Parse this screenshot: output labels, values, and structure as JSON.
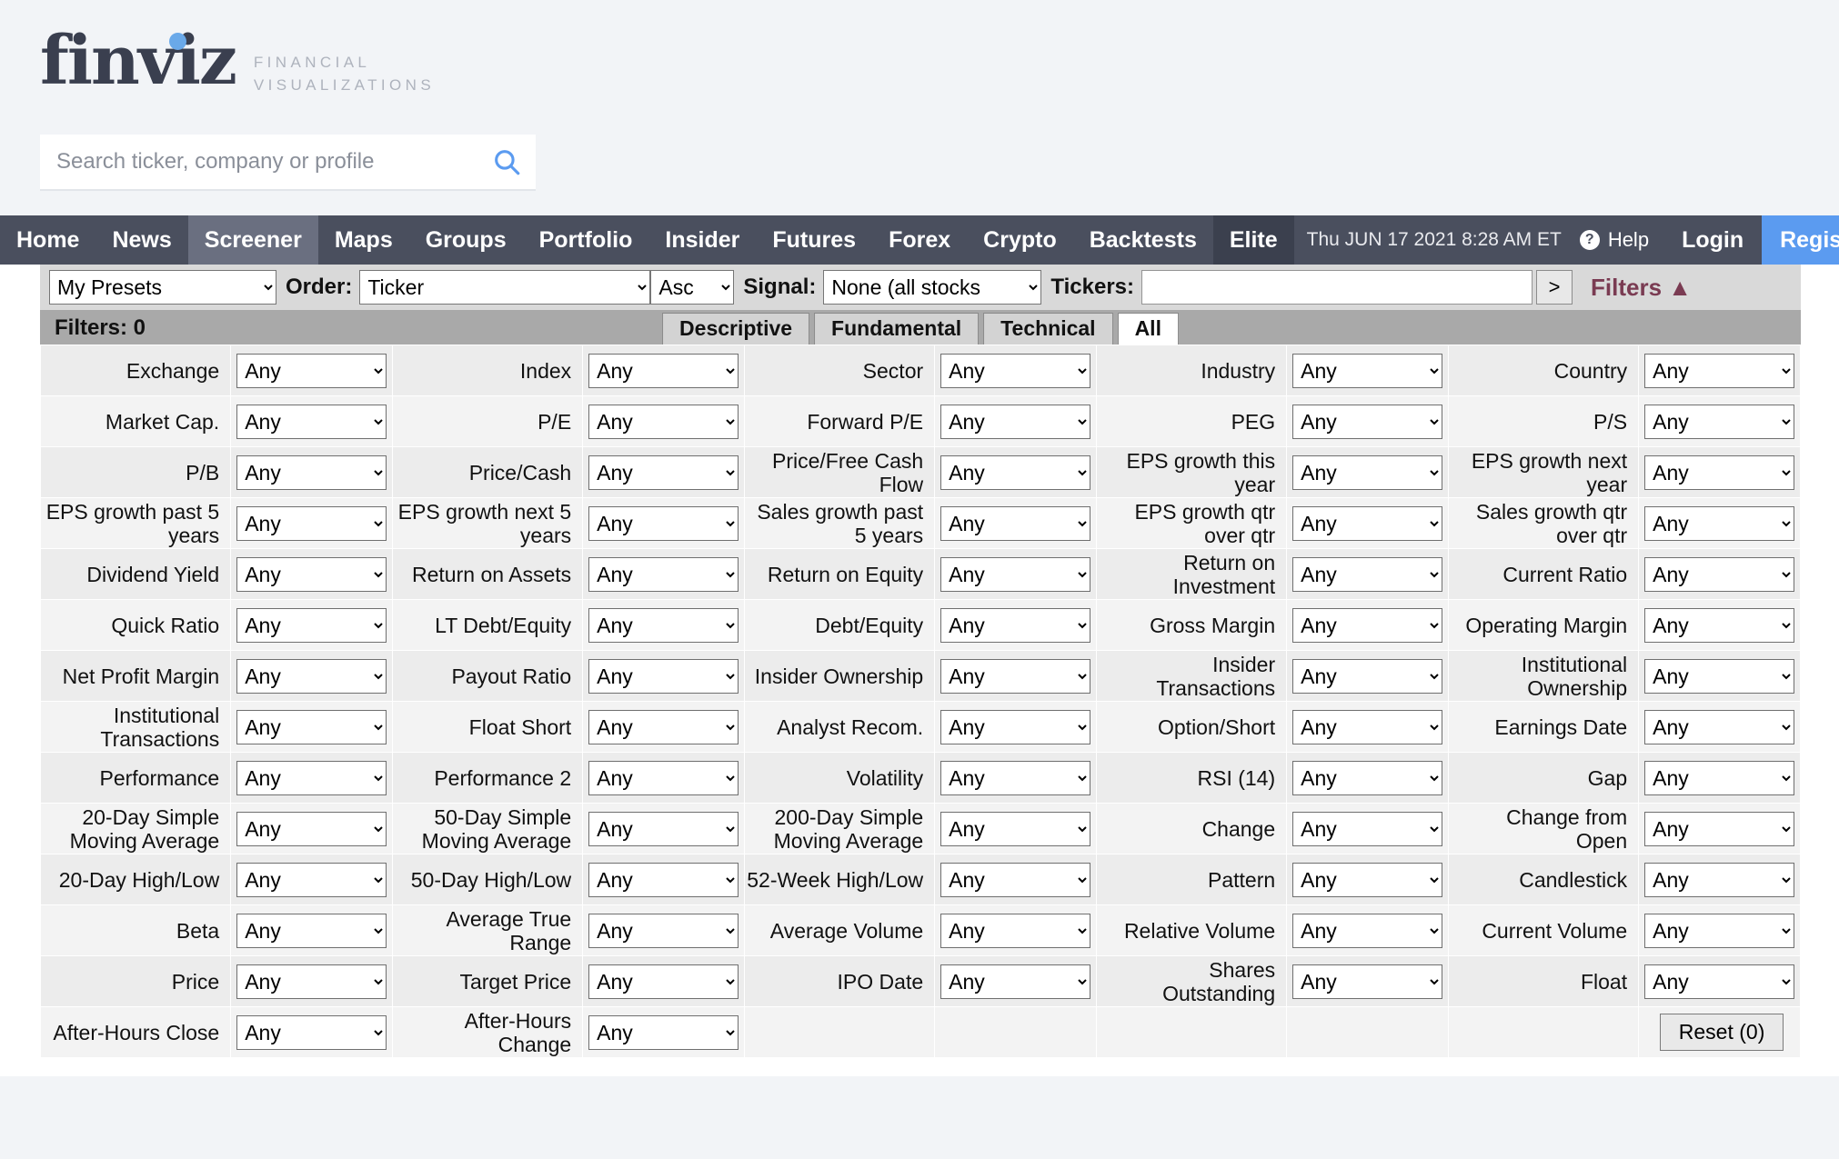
{
  "brand": {
    "name": "finviz",
    "tagline_line1": "FINANCIAL",
    "tagline_line2": "VISUALIZATIONS"
  },
  "search": {
    "placeholder": "Search ticker, company or profile",
    "value": "",
    "icon": "search-icon"
  },
  "nav": {
    "items": [
      {
        "label": "Home",
        "state": "normal"
      },
      {
        "label": "News",
        "state": "normal"
      },
      {
        "label": "Screener",
        "state": "active"
      },
      {
        "label": "Maps",
        "state": "normal"
      },
      {
        "label": "Groups",
        "state": "normal"
      },
      {
        "label": "Portfolio",
        "state": "normal"
      },
      {
        "label": "Insider",
        "state": "normal"
      },
      {
        "label": "Futures",
        "state": "normal"
      },
      {
        "label": "Forex",
        "state": "normal"
      },
      {
        "label": "Crypto",
        "state": "normal"
      },
      {
        "label": "Backtests",
        "state": "normal"
      },
      {
        "label": "Elite",
        "state": "elite"
      }
    ],
    "timestamp": "Thu JUN 17 2021 8:28 AM ET",
    "help_label": "Help",
    "help_icon": "question-mark-icon",
    "login_label": "Login",
    "register_label": "Register",
    "colors": {
      "bar": "#4a4f5e",
      "active": "#6a6f80",
      "elite": "#3b404e",
      "register": "#5b9bf0"
    }
  },
  "toolbar": {
    "presets_value": "My Presets",
    "order_label": "Order:",
    "order_value": "Ticker",
    "direction_value": "Asc",
    "signal_label": "Signal:",
    "signal_value": "None (all stocks",
    "tickers_label": "Tickers:",
    "tickers_value": "",
    "go_label": ">",
    "filters_toggle": "Filters ▲",
    "filters_toggle_color": "#7a3b52"
  },
  "tabstrip": {
    "filters_count": "Filters: 0",
    "tabs": [
      {
        "label": "Descriptive",
        "active": false
      },
      {
        "label": "Fundamental",
        "active": false
      },
      {
        "label": "Technical",
        "active": false
      },
      {
        "label": "All",
        "active": true
      }
    ]
  },
  "filters": {
    "default_value": "Any",
    "reset_label": "Reset (0)",
    "rows": [
      [
        {
          "label": "Exchange",
          "value": "Any"
        },
        {
          "label": "Index",
          "value": "Any"
        },
        {
          "label": "Sector",
          "value": "Any"
        },
        {
          "label": "Industry",
          "value": "Any"
        },
        {
          "label": "Country",
          "value": "Any"
        }
      ],
      [
        {
          "label": "Market Cap.",
          "value": "Any"
        },
        {
          "label": "P/E",
          "value": "Any"
        },
        {
          "label": "Forward P/E",
          "value": "Any"
        },
        {
          "label": "PEG",
          "value": "Any"
        },
        {
          "label": "P/S",
          "value": "Any"
        }
      ],
      [
        {
          "label": "P/B",
          "value": "Any"
        },
        {
          "label": "Price/Cash",
          "value": "Any"
        },
        {
          "label": "Price/Free Cash Flow",
          "value": "Any"
        },
        {
          "label": "EPS growth this year",
          "value": "Any"
        },
        {
          "label": "EPS growth next year",
          "value": "Any"
        }
      ],
      [
        {
          "label": "EPS growth past 5 years",
          "value": "Any"
        },
        {
          "label": "EPS growth next 5 years",
          "value": "Any"
        },
        {
          "label": "Sales growth past 5 years",
          "value": "Any"
        },
        {
          "label": "EPS growth qtr over qtr",
          "value": "Any"
        },
        {
          "label": "Sales growth qtr over qtr",
          "value": "Any"
        }
      ],
      [
        {
          "label": "Dividend Yield",
          "value": "Any"
        },
        {
          "label": "Return on Assets",
          "value": "Any"
        },
        {
          "label": "Return on Equity",
          "value": "Any"
        },
        {
          "label": "Return on Investment",
          "value": "Any"
        },
        {
          "label": "Current Ratio",
          "value": "Any"
        }
      ],
      [
        {
          "label": "Quick Ratio",
          "value": "Any"
        },
        {
          "label": "LT Debt/Equity",
          "value": "Any"
        },
        {
          "label": "Debt/Equity",
          "value": "Any"
        },
        {
          "label": "Gross Margin",
          "value": "Any"
        },
        {
          "label": "Operating Margin",
          "value": "Any"
        }
      ],
      [
        {
          "label": "Net Profit Margin",
          "value": "Any"
        },
        {
          "label": "Payout Ratio",
          "value": "Any"
        },
        {
          "label": "Insider Ownership",
          "value": "Any"
        },
        {
          "label": "Insider Transactions",
          "value": "Any"
        },
        {
          "label": "Institutional Ownership",
          "value": "Any"
        }
      ],
      [
        {
          "label": "Institutional Transactions",
          "value": "Any"
        },
        {
          "label": "Float Short",
          "value": "Any"
        },
        {
          "label": "Analyst Recom.",
          "value": "Any"
        },
        {
          "label": "Option/Short",
          "value": "Any"
        },
        {
          "label": "Earnings Date",
          "value": "Any"
        }
      ],
      [
        {
          "label": "Performance",
          "value": "Any"
        },
        {
          "label": "Performance 2",
          "value": "Any"
        },
        {
          "label": "Volatility",
          "value": "Any"
        },
        {
          "label": "RSI (14)",
          "value": "Any"
        },
        {
          "label": "Gap",
          "value": "Any"
        }
      ],
      [
        {
          "label": "20-Day Simple Moving Average",
          "value": "Any"
        },
        {
          "label": "50-Day Simple Moving Average",
          "value": "Any"
        },
        {
          "label": "200-Day Simple Moving Average",
          "value": "Any"
        },
        {
          "label": "Change",
          "value": "Any"
        },
        {
          "label": "Change from Open",
          "value": "Any"
        }
      ],
      [
        {
          "label": "20-Day High/Low",
          "value": "Any"
        },
        {
          "label": "50-Day High/Low",
          "value": "Any"
        },
        {
          "label": "52-Week High/Low",
          "value": "Any"
        },
        {
          "label": "Pattern",
          "value": "Any"
        },
        {
          "label": "Candlestick",
          "value": "Any"
        }
      ],
      [
        {
          "label": "Beta",
          "value": "Any"
        },
        {
          "label": "Average True Range",
          "value": "Any"
        },
        {
          "label": "Average Volume",
          "value": "Any"
        },
        {
          "label": "Relative Volume",
          "value": "Any"
        },
        {
          "label": "Current Volume",
          "value": "Any"
        }
      ],
      [
        {
          "label": "Price",
          "value": "Any"
        },
        {
          "label": "Target Price",
          "value": "Any"
        },
        {
          "label": "IPO Date",
          "value": "Any"
        },
        {
          "label": "Shares Outstanding",
          "value": "Any"
        },
        {
          "label": "Float",
          "value": "Any"
        }
      ],
      [
        {
          "label": "After-Hours Close",
          "value": "Any"
        },
        {
          "label": "After-Hours Change",
          "value": "Any"
        },
        {
          "label": "",
          "value": null
        },
        {
          "label": "",
          "value": null
        },
        {
          "label": "",
          "value": null,
          "reset": true
        }
      ]
    ]
  }
}
